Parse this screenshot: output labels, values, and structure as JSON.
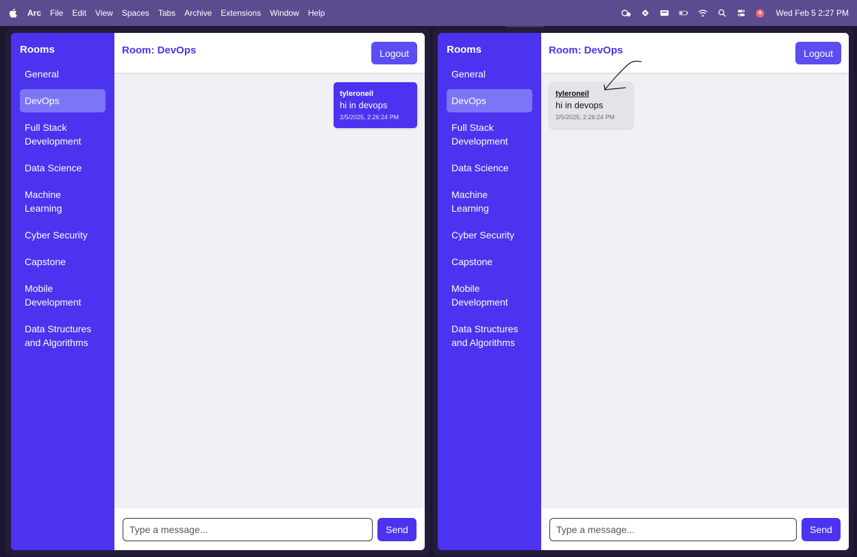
{
  "menubar": {
    "apple_icon": "apple-icon",
    "items": [
      "Arc",
      "File",
      "Edit",
      "View",
      "Spaces",
      "Tabs",
      "Archive",
      "Extensions",
      "Window",
      "Help"
    ],
    "clock": "Wed Feb 5  2:27 PM"
  },
  "sidebar": {
    "title": "Rooms",
    "items": [
      {
        "label": "General"
      },
      {
        "label": "DevOps",
        "active": true
      },
      {
        "label": "Full Stack Development"
      },
      {
        "label": "Data Science"
      },
      {
        "label": "Machine Learning"
      },
      {
        "label": "Cyber Security"
      },
      {
        "label": "Capstone"
      },
      {
        "label": "Mobile Development"
      },
      {
        "label": "Data Structures and Algorithms"
      }
    ]
  },
  "header": {
    "room_title": "Room: DevOps",
    "logout_label": "Logout"
  },
  "message": {
    "author": "tyleroneil",
    "text": "hi in devops",
    "time": "2/5/2025, 2:26:24 PM"
  },
  "composer": {
    "placeholder": "Type a message...",
    "value": "",
    "send_label": "Send"
  },
  "colors": {
    "sidebar": "#4b33f0",
    "accent": "#5c4df2",
    "active_room": "#7c75f7",
    "menubar": "#5b4c8f"
  }
}
